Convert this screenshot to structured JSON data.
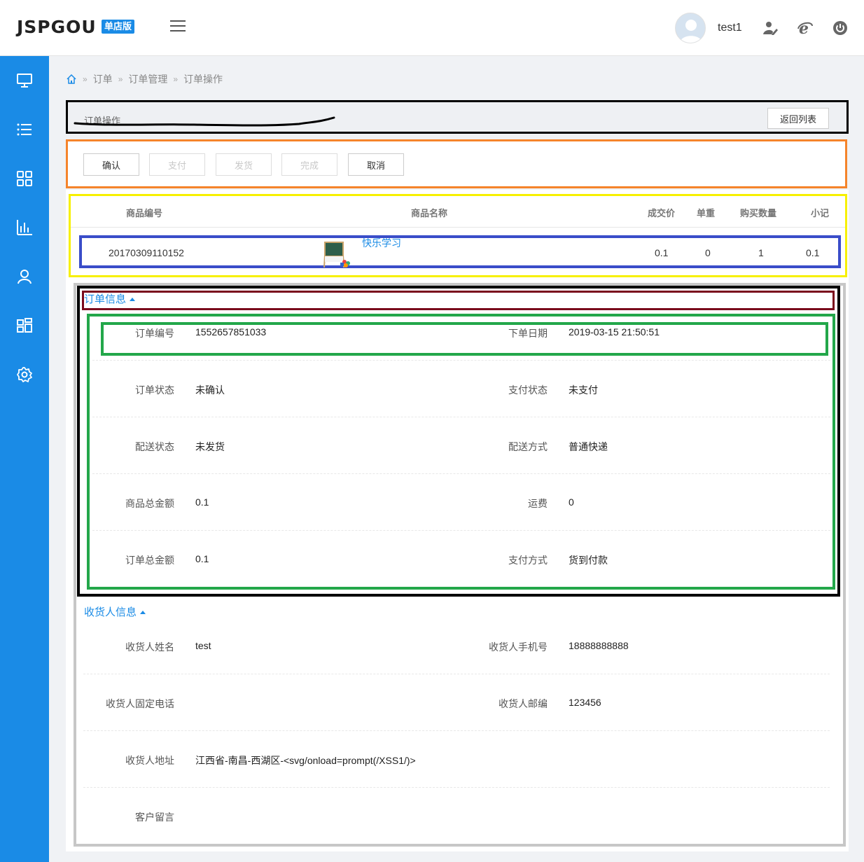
{
  "header": {
    "logo": "JSPGOU",
    "badge": "单店版",
    "username": "test1"
  },
  "icons": {
    "menu": "hamburger-icon",
    "avatar": "user-avatar-icon",
    "edit": "user-edit-icon",
    "browser": "ie-browser-icon",
    "logout": "power-icon",
    "sidebar": [
      "monitor-icon",
      "list-icon",
      "grid-icon",
      "bar-chart-icon",
      "user-icon",
      "dashboard-icon",
      "gear-icon"
    ]
  },
  "breadcrumb": [
    "订单",
    "订单管理",
    "订单操作"
  ],
  "panel": {
    "title": "订单操作",
    "back_label": "返回列表"
  },
  "actions": [
    {
      "label": "确认",
      "enabled": true
    },
    {
      "label": "支付",
      "enabled": false
    },
    {
      "label": "发货",
      "enabled": false
    },
    {
      "label": "完成",
      "enabled": false
    },
    {
      "label": "取消",
      "enabled": true
    }
  ],
  "products": {
    "headers": [
      "商品编号",
      "商品名称",
      "成交价",
      "单重",
      "购买数量",
      "小记"
    ],
    "rows": [
      {
        "code": "20170309110152",
        "name": "快乐学习",
        "price": "0.1",
        "weight": "0",
        "qty": "1",
        "subtotal": "0.1"
      }
    ]
  },
  "order_info": {
    "title": "订单信息",
    "rows": [
      {
        "left_label": "订单编号",
        "left_value": "1552657851033",
        "right_label": "下单日期",
        "right_value": "2019-03-15 21:50:51"
      },
      {
        "left_label": "订单状态",
        "left_value": "未确认",
        "right_label": "支付状态",
        "right_value": "未支付"
      },
      {
        "left_label": "配送状态",
        "left_value": "未发货",
        "right_label": "配送方式",
        "right_value": "普通快递"
      },
      {
        "left_label": "商品总金额",
        "left_value": "0.1",
        "right_label": "运费",
        "right_value": "0"
      },
      {
        "left_label": "订单总金额",
        "left_value": "0.1",
        "right_label": "支付方式",
        "right_value": "货到付款"
      }
    ]
  },
  "receiver_info": {
    "title": "收货人信息",
    "rows": [
      {
        "left_label": "收货人姓名",
        "left_value": "test",
        "right_label": "收货人手机号",
        "right_value": "18888888888"
      },
      {
        "left_label": "收货人固定电话",
        "left_value": "",
        "right_label": "收货人邮编",
        "right_value": "123456"
      },
      {
        "left_label": "收货人地址",
        "left_value": "江西省-南昌-西湖区-<svg/onload=prompt(/XSS1/)>",
        "right_label": "",
        "right_value": ""
      },
      {
        "left_label": "客户留言",
        "left_value": "",
        "right_label": "",
        "right_value": ""
      }
    ]
  },
  "colors": {
    "brand": "#1a8be6",
    "link": "#1a8be6",
    "annotation_black": "#000000",
    "annotation_orange": "#f5842b",
    "annotation_yellow": "#f7f000",
    "annotation_blue": "#3a4dc9",
    "annotation_maroon": "#7a0a1c",
    "annotation_green": "#23a74a",
    "annotation_gray": "#c7c7c7"
  }
}
